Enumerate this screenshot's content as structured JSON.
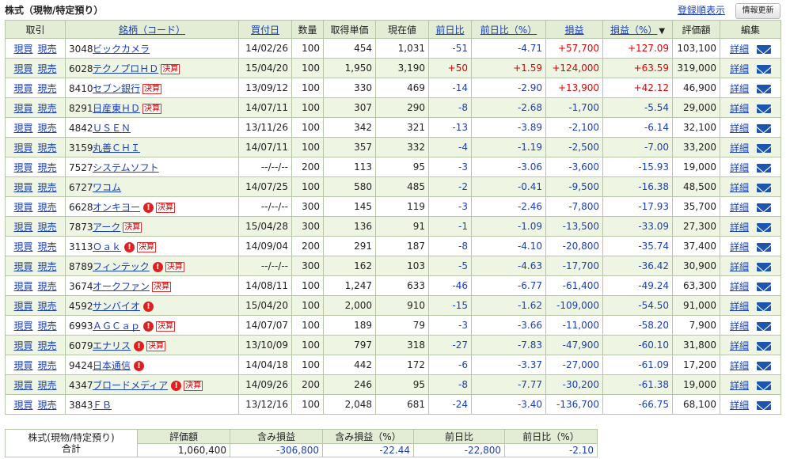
{
  "header": {
    "title": "株式（現物/特定預り）",
    "sort_link": "登録順表示",
    "refresh_button": "情報更新"
  },
  "columns": {
    "trade": "取引",
    "name": "銘柄（コード）",
    "date": "買付日",
    "qty": "数量",
    "cost": "取得単価",
    "price": "現在値",
    "chg": "前日比",
    "chg_pct": "前日比（%）",
    "pl": "損益",
    "pl_pct": "損益（%）",
    "sort_marker": "▼",
    "value": "評価額",
    "edit": "編集"
  },
  "labels": {
    "buy": "現買",
    "sell": "現売",
    "detail": "詳細",
    "alert": "!",
    "kessan": "決算"
  },
  "colors": {
    "negative": "#1a3fb8",
    "positive": "#e00000",
    "header_bg": "#e3edd6",
    "stripe_bg": "#eef5e3",
    "link": "#1a3fb8"
  },
  "rows": [
    {
      "code": "3048",
      "name": "ビックカメラ",
      "alert": false,
      "kessan": false,
      "date": "14/02/26",
      "qty": "100",
      "cost": "454",
      "price": "1,031",
      "chg": "-51",
      "chg_pct": "-4.71",
      "pl": "+57,700",
      "pl_pct": "+127.09",
      "value": "103,100"
    },
    {
      "code": "6028",
      "name": "テクノプロＨＤ",
      "alert": false,
      "kessan": true,
      "date": "15/04/20",
      "qty": "100",
      "cost": "1,950",
      "price": "3,190",
      "chg": "+50",
      "chg_pct": "+1.59",
      "pl": "+124,000",
      "pl_pct": "+63.59",
      "value": "319,000"
    },
    {
      "code": "8410",
      "name": "セブン銀行",
      "alert": false,
      "kessan": true,
      "date": "13/09/12",
      "qty": "100",
      "cost": "330",
      "price": "469",
      "chg": "-14",
      "chg_pct": "-2.90",
      "pl": "+13,900",
      "pl_pct": "+42.12",
      "value": "46,900"
    },
    {
      "code": "8291",
      "name": "日産東ＨＤ",
      "alert": false,
      "kessan": true,
      "date": "14/07/11",
      "qty": "100",
      "cost": "307",
      "price": "290",
      "chg": "-8",
      "chg_pct": "-2.68",
      "pl": "-1,700",
      "pl_pct": "-5.54",
      "value": "29,000"
    },
    {
      "code": "4842",
      "name": "ＵＳＥＮ",
      "alert": false,
      "kessan": false,
      "date": "13/11/26",
      "qty": "100",
      "cost": "342",
      "price": "321",
      "chg": "-13",
      "chg_pct": "-3.89",
      "pl": "-2,100",
      "pl_pct": "-6.14",
      "value": "32,100"
    },
    {
      "code": "3159",
      "name": "丸善ＣＨＩ",
      "alert": false,
      "kessan": false,
      "date": "14/07/11",
      "qty": "100",
      "cost": "357",
      "price": "332",
      "chg": "-4",
      "chg_pct": "-1.19",
      "pl": "-2,500",
      "pl_pct": "-7.00",
      "value": "33,200"
    },
    {
      "code": "7527",
      "name": "システムソフト",
      "alert": false,
      "kessan": false,
      "date": "--/--/--",
      "qty": "200",
      "cost": "113",
      "price": "95",
      "chg": "-3",
      "chg_pct": "-3.06",
      "pl": "-3,600",
      "pl_pct": "-15.93",
      "value": "19,000"
    },
    {
      "code": "6727",
      "name": "ワコム",
      "alert": false,
      "kessan": false,
      "date": "14/07/25",
      "qty": "100",
      "cost": "580",
      "price": "485",
      "chg": "-2",
      "chg_pct": "-0.41",
      "pl": "-9,500",
      "pl_pct": "-16.38",
      "value": "48,500"
    },
    {
      "code": "6628",
      "name": "オンキヨー",
      "alert": true,
      "kessan": true,
      "date": "--/--/--",
      "qty": "300",
      "cost": "145",
      "price": "119",
      "chg": "-3",
      "chg_pct": "-2.46",
      "pl": "-7,800",
      "pl_pct": "-17.93",
      "value": "35,700"
    },
    {
      "code": "7873",
      "name": "アーク",
      "alert": false,
      "kessan": true,
      "date": "15/04/28",
      "qty": "300",
      "cost": "136",
      "price": "91",
      "chg": "-1",
      "chg_pct": "-1.09",
      "pl": "-13,500",
      "pl_pct": "-33.09",
      "value": "27,300"
    },
    {
      "code": "3113",
      "name": "Ｏａｋ",
      "alert": true,
      "kessan": true,
      "date": "14/09/04",
      "qty": "200",
      "cost": "291",
      "price": "187",
      "chg": "-8",
      "chg_pct": "-4.10",
      "pl": "-20,800",
      "pl_pct": "-35.74",
      "value": "37,400"
    },
    {
      "code": "8789",
      "name": "フィンテック",
      "alert": true,
      "kessan": true,
      "date": "--/--/--",
      "qty": "300",
      "cost": "162",
      "price": "103",
      "chg": "-5",
      "chg_pct": "-4.63",
      "pl": "-17,700",
      "pl_pct": "-36.42",
      "value": "30,900"
    },
    {
      "code": "3674",
      "name": "オークファン",
      "alert": false,
      "kessan": true,
      "date": "14/08/11",
      "qty": "100",
      "cost": "1,247",
      "price": "633",
      "chg": "-46",
      "chg_pct": "-6.77",
      "pl": "-61,400",
      "pl_pct": "-49.24",
      "value": "63,300"
    },
    {
      "code": "4592",
      "name": "サンバイオ",
      "alert": true,
      "kessan": false,
      "date": "15/04/20",
      "qty": "100",
      "cost": "2,000",
      "price": "910",
      "chg": "-15",
      "chg_pct": "-1.62",
      "pl": "-109,000",
      "pl_pct": "-54.50",
      "value": "91,000"
    },
    {
      "code": "6993",
      "name": "ＡＧＣａｐ",
      "alert": true,
      "kessan": true,
      "date": "14/07/07",
      "qty": "100",
      "cost": "189",
      "price": "79",
      "chg": "-3",
      "chg_pct": "-3.66",
      "pl": "-11,000",
      "pl_pct": "-58.20",
      "value": "7,900"
    },
    {
      "code": "6079",
      "name": "エナリス",
      "alert": true,
      "kessan": true,
      "date": "13/10/09",
      "qty": "100",
      "cost": "797",
      "price": "318",
      "chg": "-27",
      "chg_pct": "-7.83",
      "pl": "-47,900",
      "pl_pct": "-60.10",
      "value": "31,800"
    },
    {
      "code": "9424",
      "name": "日本通信",
      "alert": true,
      "kessan": false,
      "date": "14/04/18",
      "qty": "100",
      "cost": "442",
      "price": "172",
      "chg": "-6",
      "chg_pct": "-3.37",
      "pl": "-27,000",
      "pl_pct": "-61.09",
      "value": "17,200"
    },
    {
      "code": "4347",
      "name": "ブロードメディア",
      "alert": true,
      "kessan": true,
      "date": "14/09/26",
      "qty": "200",
      "cost": "246",
      "price": "95",
      "chg": "-8",
      "chg_pct": "-7.77",
      "pl": "-30,200",
      "pl_pct": "-61.38",
      "value": "19,000"
    },
    {
      "code": "3843",
      "name": "ＦＢ",
      "alert": false,
      "kessan": false,
      "date": "13/12/16",
      "qty": "100",
      "cost": "2,048",
      "price": "681",
      "chg": "-24",
      "chg_pct": "-3.40",
      "pl": "-136,700",
      "pl_pct": "-66.75",
      "value": "68,100"
    }
  ],
  "summary": {
    "label_line1": "株式(現物/特定預り)",
    "label_line2": "合計",
    "headers": [
      "評価額",
      "含み損益",
      "含み損益（%）",
      "前日比",
      "前日比（%）"
    ],
    "values": [
      "1,060,400",
      "-306,800",
      "-22.44",
      "-22,800",
      "-2.10"
    ]
  }
}
